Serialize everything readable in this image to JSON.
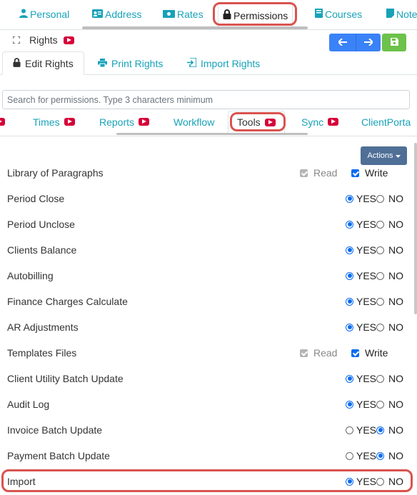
{
  "top_tabs": [
    {
      "label": "Personal",
      "icon": "person-icon"
    },
    {
      "label": "Address",
      "icon": "address-card-icon"
    },
    {
      "label": "Rates",
      "icon": "money-bill-icon"
    },
    {
      "label": "Permissions",
      "icon": "lock-icon"
    },
    {
      "label": "Courses",
      "icon": "book-icon"
    },
    {
      "label": "Note",
      "icon": "note-icon"
    }
  ],
  "rights": {
    "label": "Rights",
    "icon": "expand-icon",
    "video": "youtube-icon"
  },
  "toolbar": {
    "back_icon": "arrow-left-icon",
    "forward_icon": "arrow-right-icon",
    "save_icon": "save-icon"
  },
  "sub_tabs": [
    {
      "label": "Edit Rights",
      "icon": "lock-icon"
    },
    {
      "label": "Print Rights",
      "icon": "print-icon"
    },
    {
      "label": "Import Rights",
      "icon": "import-icon"
    }
  ],
  "search": {
    "placeholder": "Search for permissions. Type 3 characters minimum"
  },
  "category_tabs": [
    {
      "label": "Times",
      "video": true
    },
    {
      "label": "Reports",
      "video": true
    },
    {
      "label": "Workflow",
      "video": false
    },
    {
      "label": "Tools",
      "video": true
    },
    {
      "label": "Sync",
      "video": true
    },
    {
      "label": "ClientPorta",
      "video": false
    }
  ],
  "actions": {
    "label": "Actions"
  },
  "option_labels": {
    "read": "Read",
    "write": "Write",
    "yes": "YES",
    "no": "NO"
  },
  "permissions": [
    {
      "label": "Library of Paragraphs",
      "type": "rw",
      "read": true,
      "write": true
    },
    {
      "label": "Period Close",
      "type": "yn",
      "value": "YES"
    },
    {
      "label": "Period Unclose",
      "type": "yn",
      "value": "YES"
    },
    {
      "label": "Clients Balance",
      "type": "yn",
      "value": "YES"
    },
    {
      "label": "Autobilling",
      "type": "yn",
      "value": "YES"
    },
    {
      "label": "Finance Charges Calculate",
      "type": "yn",
      "value": "YES"
    },
    {
      "label": "AR Adjustments",
      "type": "yn",
      "value": "YES"
    },
    {
      "label": "Templates Files",
      "type": "rw",
      "read": true,
      "write": true
    },
    {
      "label": "Client Utility Batch Update",
      "type": "yn",
      "value": "YES"
    },
    {
      "label": "Audit Log",
      "type": "yn",
      "value": "YES"
    },
    {
      "label": "Invoice Batch Update",
      "type": "yn",
      "value": "NO"
    },
    {
      "label": "Payment Batch Update",
      "type": "yn",
      "value": "NO"
    },
    {
      "label": "Import",
      "type": "yn",
      "value": "YES"
    }
  ],
  "colors": {
    "accent": "#17a2b8",
    "primary": "#3a82f7",
    "success": "#6cc24a",
    "highlight": "#d9534f",
    "actions_bg": "#4f6f96"
  }
}
